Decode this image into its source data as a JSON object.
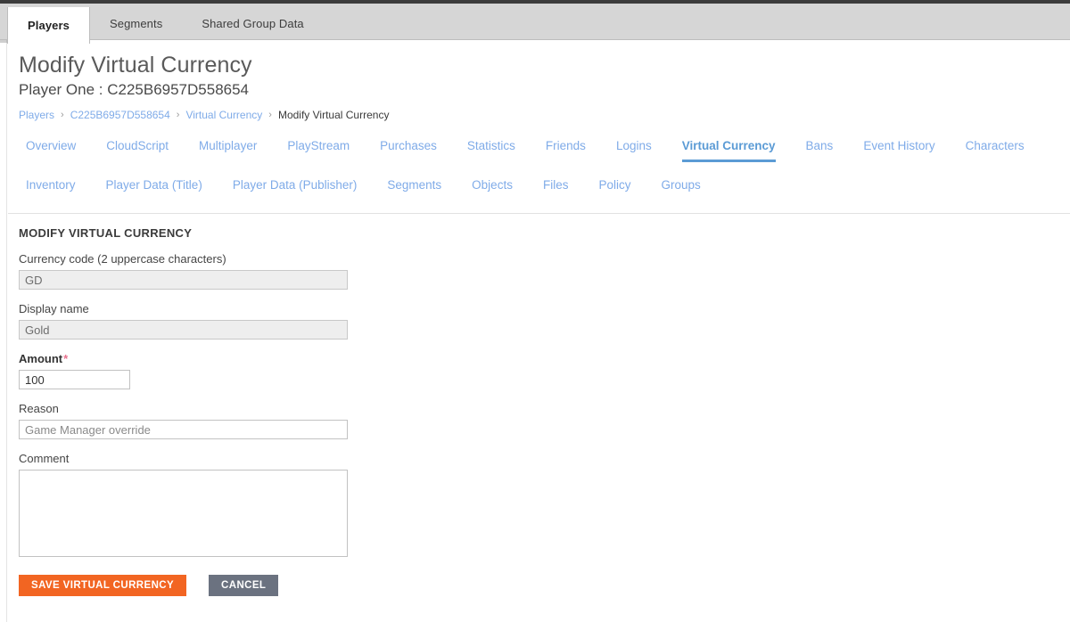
{
  "top_tabs": [
    {
      "label": "Players",
      "active": true
    },
    {
      "label": "Segments",
      "active": false
    },
    {
      "label": "Shared Group Data",
      "active": false
    }
  ],
  "header": {
    "title": "Modify Virtual Currency",
    "subtitle": "Player One : C225B6957D558654"
  },
  "breadcrumb": {
    "separator": "›",
    "items": [
      {
        "label": "Players",
        "current": false
      },
      {
        "label": "C225B6957D558654",
        "current": false
      },
      {
        "label": "Virtual Currency",
        "current": false
      },
      {
        "label": "Modify Virtual Currency",
        "current": true
      }
    ]
  },
  "player_nav": {
    "row1": [
      {
        "label": "Overview",
        "active": false
      },
      {
        "label": "CloudScript",
        "active": false
      },
      {
        "label": "Multiplayer",
        "active": false
      },
      {
        "label": "PlayStream",
        "active": false
      },
      {
        "label": "Purchases",
        "active": false
      },
      {
        "label": "Statistics",
        "active": false
      },
      {
        "label": "Friends",
        "active": false
      },
      {
        "label": "Logins",
        "active": false
      },
      {
        "label": "Virtual Currency",
        "active": true
      },
      {
        "label": "Bans",
        "active": false
      },
      {
        "label": "Event History",
        "active": false
      },
      {
        "label": "Characters",
        "active": false
      }
    ],
    "row2": [
      {
        "label": "Inventory",
        "active": false
      },
      {
        "label": "Player Data (Title)",
        "active": false
      },
      {
        "label": "Player Data (Publisher)",
        "active": false
      },
      {
        "label": "Segments",
        "active": false
      },
      {
        "label": "Objects",
        "active": false
      },
      {
        "label": "Files",
        "active": false
      },
      {
        "label": "Policy",
        "active": false
      },
      {
        "label": "Groups",
        "active": false
      }
    ]
  },
  "form": {
    "section_title": "MODIFY VIRTUAL CURRENCY",
    "currency_code": {
      "label": "Currency code (2 uppercase characters)",
      "value": "GD",
      "disabled": true
    },
    "display_name": {
      "label": "Display name",
      "value": "Gold",
      "disabled": true
    },
    "amount": {
      "label": "Amount",
      "required_marker": "*",
      "value": "100"
    },
    "reason": {
      "label": "Reason",
      "value": "",
      "placeholder": "Game Manager override"
    },
    "comment": {
      "label": "Comment",
      "value": "",
      "placeholder": ""
    },
    "save_button": "SAVE VIRTUAL CURRENCY",
    "cancel_button": "CANCEL"
  },
  "colors": {
    "primary_button": "#f26522",
    "secondary_button": "#6b7280",
    "link": "#7fabe8",
    "active_nav": "#5b9bd5",
    "required_star": "#e8718d",
    "tabbar_bg": "#d6d6d6"
  }
}
